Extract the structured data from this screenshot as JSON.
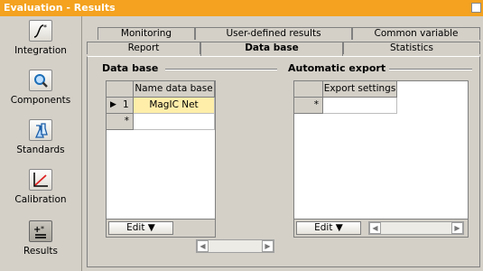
{
  "window": {
    "title": "Evaluation - Results"
  },
  "sidebar": {
    "items": [
      {
        "label": "Integration",
        "icon": "integration-icon"
      },
      {
        "label": "Components",
        "icon": "magnifier-icon"
      },
      {
        "label": "Standards",
        "icon": "standards-icon"
      },
      {
        "label": "Calibration",
        "icon": "calibration-curve-icon"
      },
      {
        "label": "Results",
        "icon": "results-icon"
      }
    ]
  },
  "tabs": {
    "row1": [
      "Monitoring",
      "User-defined results",
      "Common variable"
    ],
    "row2": [
      "Report",
      "Data base",
      "Statistics"
    ],
    "active": "Data base"
  },
  "database": {
    "title": "Data base",
    "column": "Name data base",
    "rows": [
      {
        "index": "1",
        "marker": "▶",
        "name": "MagIC Net"
      }
    ],
    "new_row_marker": "*",
    "edit_label": "Edit ▼"
  },
  "export": {
    "title": "Automatic export",
    "column": "Export settings",
    "new_row_marker": "*",
    "edit_label": "Edit ▼"
  },
  "colors": {
    "title_bar": "#f4a21f",
    "selected_cell": "#ffeeaa",
    "window_bg": "#d4d0c8"
  }
}
